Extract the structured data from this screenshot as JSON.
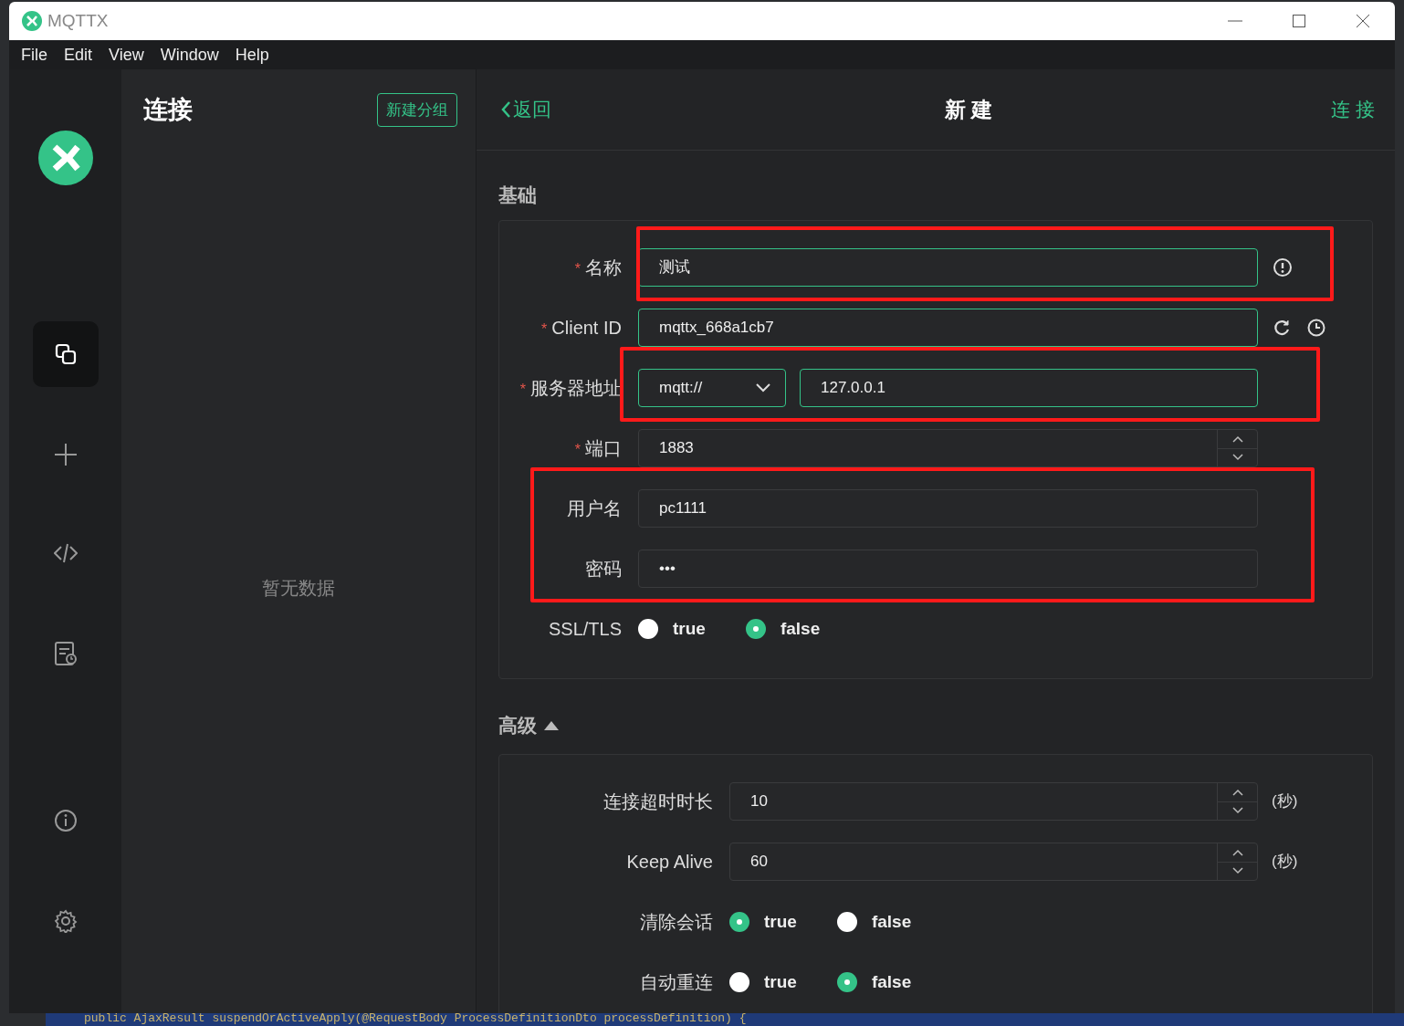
{
  "window": {
    "title": "MQTTX"
  },
  "menu": [
    "File",
    "Edit",
    "View",
    "Window",
    "Help"
  ],
  "sidebar": {
    "items": [
      {
        "selected": true
      },
      {
        "selected": false
      },
      {
        "selected": false
      },
      {
        "selected": false
      },
      {
        "selected": false
      },
      {
        "selected": false
      }
    ]
  },
  "connections": {
    "title": "连接",
    "new_group_button": "新建分组",
    "empty_text": "暂无数据"
  },
  "header": {
    "back": "返回",
    "title": "新 建",
    "connect": "连 接"
  },
  "basic": {
    "title": "基础",
    "fields": [
      {
        "label": "名称",
        "required_mark": "*",
        "kind": "text",
        "value": "测试",
        "validated": true,
        "highlighted": true
      },
      {
        "label": "Client ID",
        "required_mark": "*",
        "kind": "text",
        "value": "mqttx_668a1cb7",
        "validated": true,
        "highlighted": false
      },
      {
        "label": "服务器地址",
        "required_mark": "*",
        "kind": "address",
        "protocol": "mqtt://",
        "value": "127.0.0.1",
        "validated": true,
        "highlighted": true
      },
      {
        "label": "端口",
        "required_mark": "*",
        "kind": "number",
        "value": "1883",
        "validated": false,
        "highlighted": false
      },
      {
        "label": "用户名",
        "kind": "text",
        "value": "pc1111",
        "validated": false,
        "highlighted": true
      },
      {
        "label": "密码",
        "kind": "text",
        "value": "•••",
        "validated": false,
        "highlighted": true
      },
      {
        "label": "SSL/TLS",
        "kind": "radio",
        "options": [
          {
            "label": "true",
            "selected": false
          },
          {
            "label": "false",
            "selected": true
          }
        ],
        "highlighted": false
      }
    ]
  },
  "advanced": {
    "title": "高级",
    "expanded": true,
    "fields": [
      {
        "label": "连接超时时长",
        "kind": "number",
        "value": "10",
        "unit": "(秒)"
      },
      {
        "label": "Keep Alive",
        "kind": "number",
        "value": "60",
        "unit": "(秒)"
      },
      {
        "label": "清除会话",
        "kind": "radio",
        "options": [
          {
            "label": "true",
            "selected": true
          },
          {
            "label": "false",
            "selected": false
          }
        ]
      },
      {
        "label": "自动重连",
        "kind": "radio",
        "options": [
          {
            "label": "true",
            "selected": false
          },
          {
            "label": "false",
            "selected": true
          }
        ]
      }
    ]
  },
  "background_code": "public AjaxResult suspendOrActiveApply(@RequestBody ProcessDefinitionDto processDefinition) {"
}
